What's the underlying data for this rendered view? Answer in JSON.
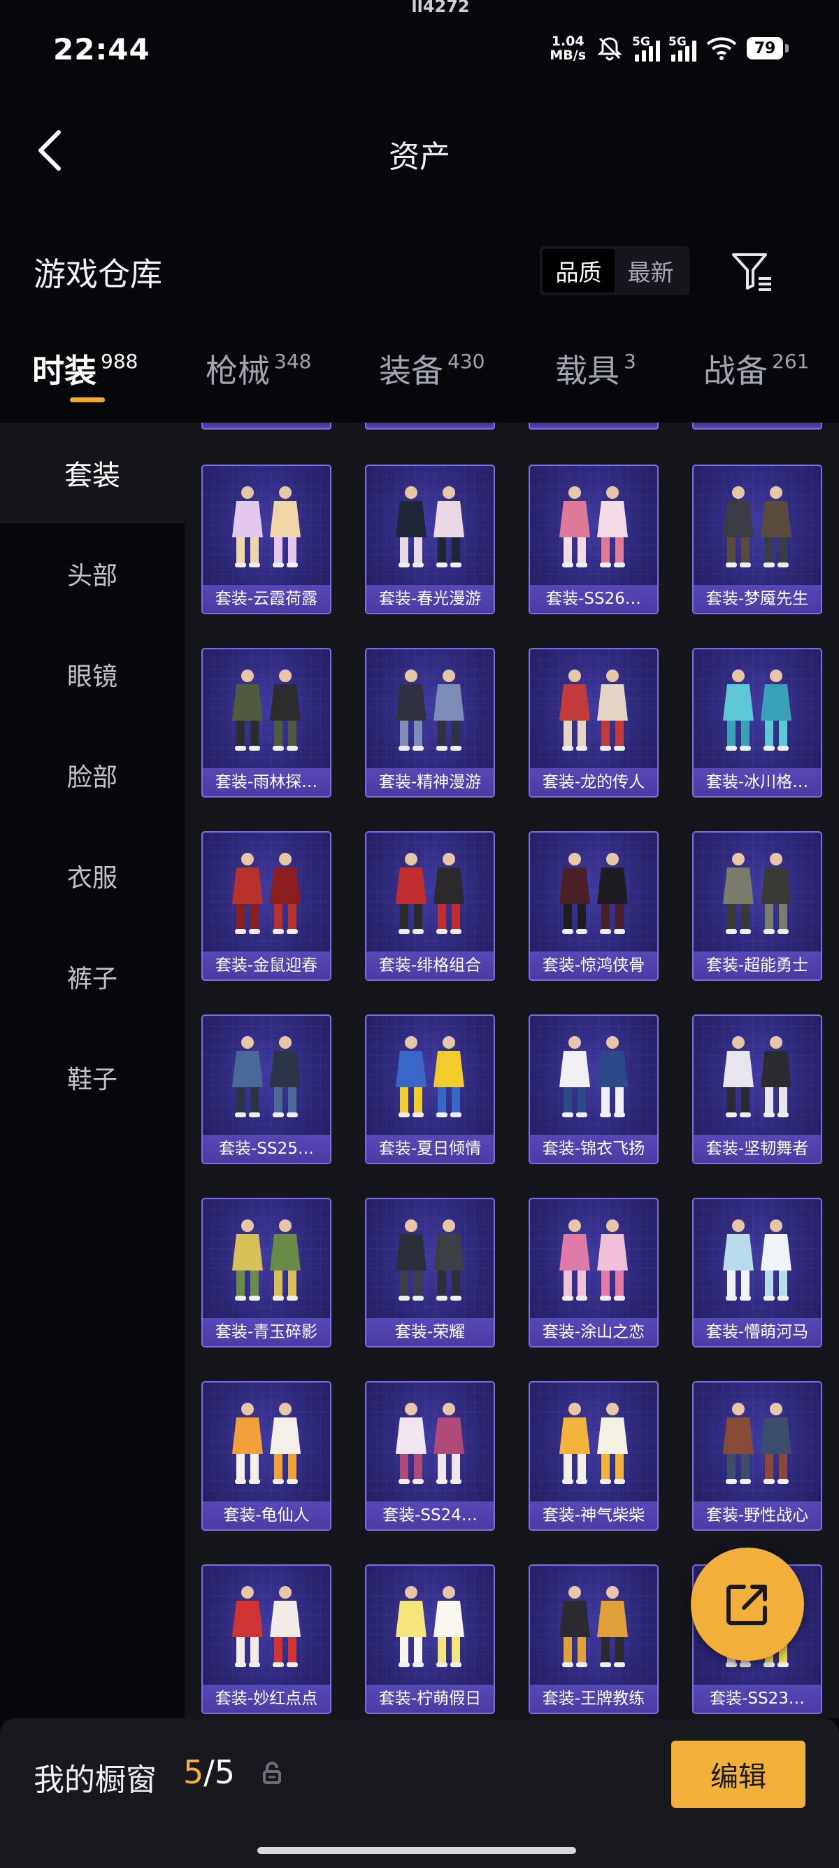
{
  "status_bar": {
    "carrier": "ll4272",
    "time": "22:44",
    "net_speed_value": "1.04",
    "net_speed_unit": "MB/s",
    "signal_label_1": "5G",
    "signal_label_2": "5G",
    "battery": "79"
  },
  "nav": {
    "title": "资产"
  },
  "header": {
    "section_title": "游戏仓库",
    "sort_options": [
      "品质",
      "最新"
    ],
    "sort_selected": "品质"
  },
  "main_tabs": [
    {
      "label": "时装",
      "count": "988",
      "active": true
    },
    {
      "label": "枪械",
      "count": "348"
    },
    {
      "label": "装备",
      "count": "430"
    },
    {
      "label": "载具",
      "count": "3"
    },
    {
      "label": "战备",
      "count": "261"
    }
  ],
  "sidebar": {
    "items": [
      {
        "label": "套装",
        "active": true
      },
      {
        "label": "头部"
      },
      {
        "label": "眼镜"
      },
      {
        "label": "脸部"
      },
      {
        "label": "衣服"
      },
      {
        "label": "裤子"
      },
      {
        "label": "鞋子"
      }
    ]
  },
  "items": [
    {
      "name": "套装-云霞荷露",
      "icon": "outfit-icon",
      "palette": [
        "#e4c7ee",
        "#f1d7a8"
      ]
    },
    {
      "name": "套装-春光漫游",
      "icon": "outfit-icon",
      "palette": [
        "#1f2636",
        "#e8d9e4"
      ]
    },
    {
      "name": "套装-SS26…",
      "icon": "outfit-icon",
      "palette": [
        "#e07a9a",
        "#f2dbe4"
      ]
    },
    {
      "name": "套装-梦魇先生",
      "icon": "outfit-icon",
      "palette": [
        "#3b3b44",
        "#5a4c3c"
      ]
    },
    {
      "name": "套装-雨林探…",
      "icon": "outfit-icon",
      "palette": [
        "#4f5a3e",
        "#2c2c2c"
      ]
    },
    {
      "name": "套装-精神漫游",
      "icon": "outfit-icon",
      "palette": [
        "#2f3140",
        "#7d8db8"
      ]
    },
    {
      "name": "套装-龙的传人",
      "icon": "outfit-icon",
      "palette": [
        "#c23a3a",
        "#e6d4c4"
      ]
    },
    {
      "name": "套装-冰川格…",
      "icon": "outfit-icon",
      "palette": [
        "#5fc8d6",
        "#3aa2b6"
      ]
    },
    {
      "name": "套装-金鼠迎春",
      "icon": "outfit-icon",
      "palette": [
        "#b8322c",
        "#8a1e1e"
      ]
    },
    {
      "name": "套装-绯格组合",
      "icon": "outfit-icon",
      "palette": [
        "#c22e2e",
        "#2a2a2a"
      ]
    },
    {
      "name": "套装-惊鸿侠骨",
      "icon": "outfit-icon",
      "palette": [
        "#4a2026",
        "#1c1c22"
      ]
    },
    {
      "name": "套装-超能勇士",
      "icon": "outfit-icon",
      "palette": [
        "#7a7c6c",
        "#3a3a34"
      ]
    },
    {
      "name": "套装-SS25…",
      "icon": "outfit-icon",
      "palette": [
        "#4a6898",
        "#2a3446"
      ]
    },
    {
      "name": "套装-夏日倾情",
      "icon": "outfit-icon",
      "palette": [
        "#3a66c8",
        "#f2cc2a"
      ]
    },
    {
      "name": "套装-锦衣飞扬",
      "icon": "outfit-icon",
      "palette": [
        "#f0f0f4",
        "#2c4a8a"
      ]
    },
    {
      "name": "套装-坚韧舞者",
      "icon": "outfit-icon",
      "palette": [
        "#e8e6ec",
        "#2a2a30"
      ]
    },
    {
      "name": "套装-青玉碎影",
      "icon": "outfit-icon",
      "palette": [
        "#d8c058",
        "#6a8a48"
      ]
    },
    {
      "name": "套装-荣耀",
      "icon": "outfit-icon",
      "palette": [
        "#2c2e3a",
        "#3c3e48"
      ]
    },
    {
      "name": "套装-涂山之恋",
      "icon": "outfit-icon",
      "palette": [
        "#e07aa8",
        "#f0c0d8"
      ]
    },
    {
      "name": "套装-懵萌河马",
      "icon": "outfit-icon",
      "palette": [
        "#b8dcea",
        "#eef4f8"
      ]
    },
    {
      "name": "套装-龟仙人",
      "icon": "outfit-icon",
      "palette": [
        "#f2a03a",
        "#f4f0e8"
      ]
    },
    {
      "name": "套装-SS24…",
      "icon": "outfit-icon",
      "palette": [
        "#f0e6ee",
        "#b04a78"
      ]
    },
    {
      "name": "套装-神气柴柴",
      "icon": "outfit-icon",
      "palette": [
        "#f2b43a",
        "#f4f0e4"
      ]
    },
    {
      "name": "套装-野性战心",
      "icon": "outfit-icon",
      "palette": [
        "#8a4a3a",
        "#3c4e6a"
      ]
    },
    {
      "name": "套装-妙红点点",
      "icon": "outfit-icon",
      "palette": [
        "#d23434",
        "#f2ece4"
      ]
    },
    {
      "name": "套装-柠萌假日",
      "icon": "outfit-icon",
      "palette": [
        "#f4e67a",
        "#f8f6ee"
      ]
    },
    {
      "name": "套装-王牌教练",
      "icon": "outfit-icon",
      "palette": [
        "#2a2a30",
        "#e0a03a"
      ]
    },
    {
      "name": "套装-SS23…",
      "icon": "outfit-icon",
      "palette": [
        "#f2d84a",
        "#d8d0c0"
      ]
    }
  ],
  "fab": {
    "icon": "share-icon"
  },
  "bottom_bar": {
    "label": "我的橱窗",
    "count_current": "5",
    "count_sep": "/",
    "count_total": "5",
    "edit_label": "编辑"
  },
  "colors": {
    "accent": "#f2b03a",
    "card_border": "#7c6de0",
    "background": "#06070b"
  }
}
